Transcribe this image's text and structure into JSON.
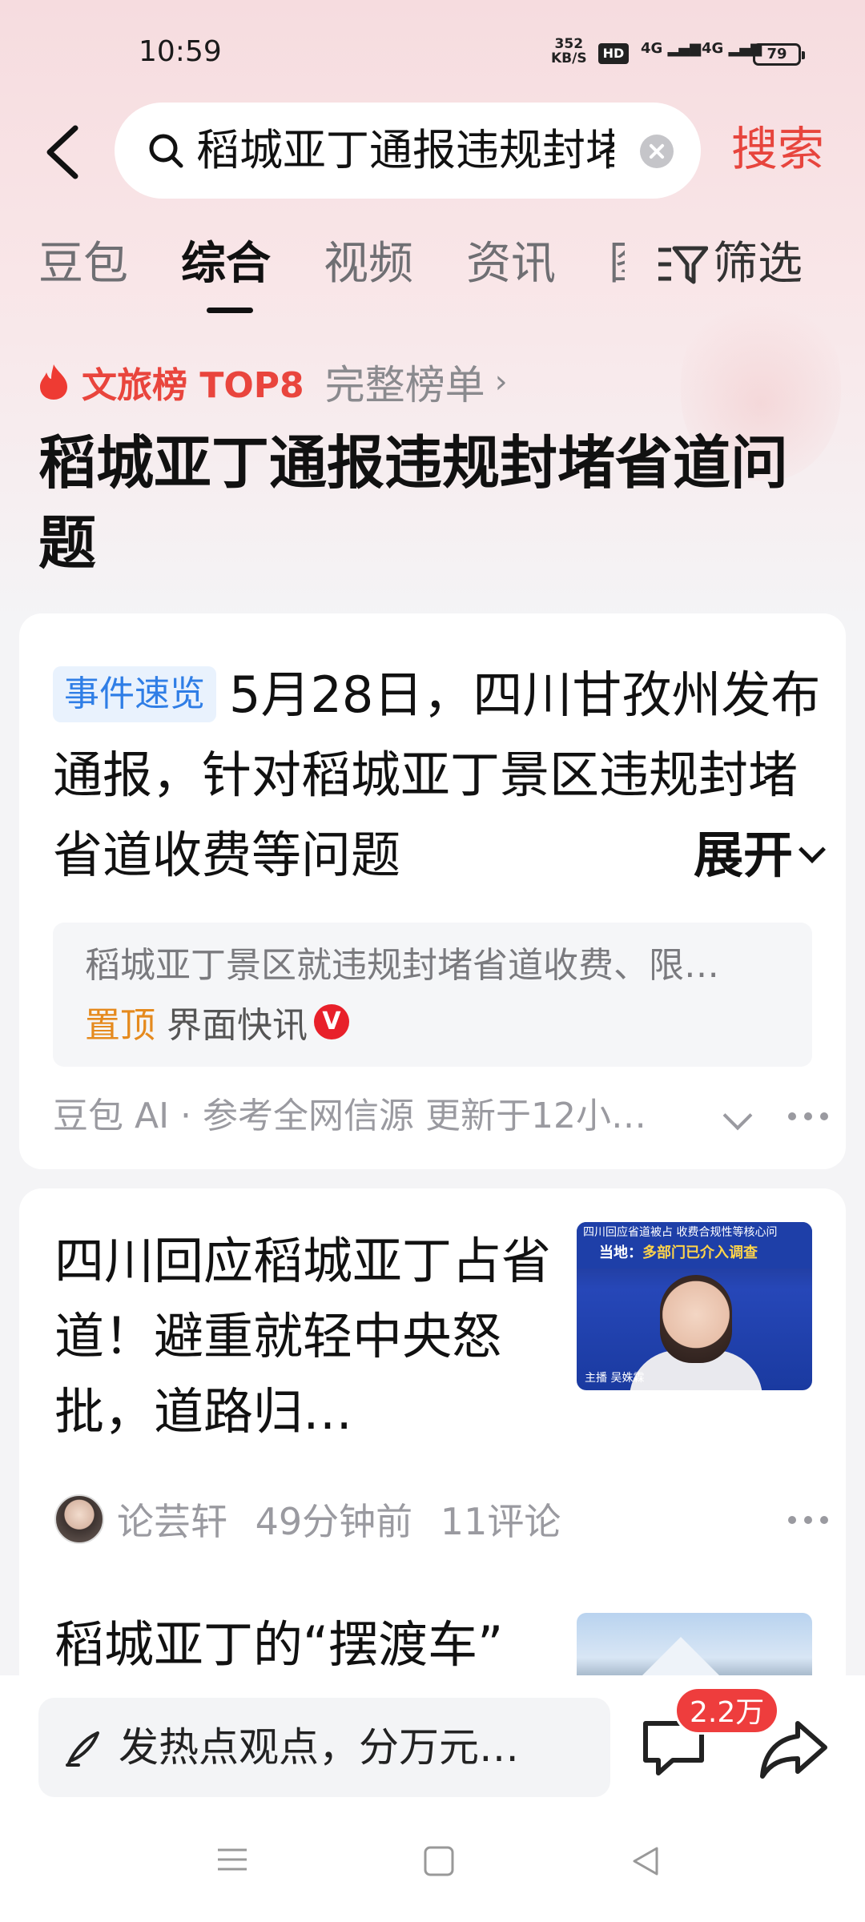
{
  "status_bar": {
    "time": "10:59",
    "net_speed": "352",
    "net_unit": "KB/S",
    "hd_label": "HD",
    "signal1": "4G",
    "signal2": "4G",
    "battery": "79"
  },
  "search": {
    "query": "稻城亚丁通报违规封堵省道问题",
    "button_label": "搜索"
  },
  "tabs": [
    {
      "label": "豆包"
    },
    {
      "label": "综合",
      "active": true
    },
    {
      "label": "视频"
    },
    {
      "label": "资讯"
    },
    {
      "label": "图"
    }
  ],
  "filter_label": "筛选",
  "ranking": {
    "label": "文旅榜 TOP8",
    "more": "完整榜单"
  },
  "topic_title": "稻城亚丁通报违规封堵省道问题",
  "summary_card": {
    "badge": "事件速览",
    "text": "5月28日，四川甘孜州发布通报，针对稻城亚丁景区违规封堵省道收费等问题",
    "expand_label": "展开",
    "source_title": "稻城亚丁景区就违规封堵省道收费、限…",
    "source_pin": "置顶",
    "source_name": "界面快讯",
    "verified_mark": "V",
    "footer": "豆包 AI · 参考全网信源 更新于12小…"
  },
  "news": [
    {
      "title": "四川回应稻城亚丁占省道！避重就轻中央怒批，道路归…",
      "thumb_text_top": "四川回应省道被占 收费合规性等核心问",
      "thumb_headline_prefix": "当地：",
      "thumb_headline": "多部门已介入调查",
      "thumb_caption": "主播 吴姝霖",
      "author": "论芸轩",
      "time": "49分钟前",
      "comments": "11评论"
    },
    {
      "title": "稻城亚丁的“摆渡车”"
    }
  ],
  "bottom_bar": {
    "comment_placeholder": "发热点观点，分万元…",
    "comment_count": "2.2万"
  },
  "colors": {
    "accent_red": "#e7453d",
    "badge_blue": "#2f7ee6",
    "pin_orange": "#e58a1e"
  }
}
